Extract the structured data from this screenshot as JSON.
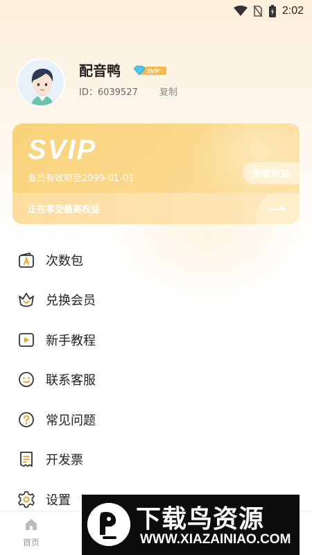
{
  "status_bar": {
    "time": "2:02",
    "icons": [
      "wifi-icon",
      "no-sim-icon",
      "battery-charging-icon"
    ]
  },
  "profile": {
    "username": "配音鸭",
    "badge": "SVIP",
    "user_id": "ID：6039527",
    "copy_label": "复制"
  },
  "svip_card": {
    "logo": "SVIP",
    "expire_text": "会员有效期至2099-01-01",
    "view_rights_label": "查看权益",
    "status_text": "正在享受最高权益"
  },
  "menu": {
    "items": [
      {
        "label": "次数包",
        "icon": "wallet-a-icon"
      },
      {
        "label": "兑换会员",
        "icon": "crown-bag-icon"
      },
      {
        "label": "新手教程",
        "icon": "play-icon"
      },
      {
        "label": "联系客服",
        "icon": "smile-face-icon"
      },
      {
        "label": "常见问题",
        "icon": "question-icon"
      },
      {
        "label": "开发票",
        "icon": "invoice-icon"
      },
      {
        "label": "设置",
        "icon": "gear-icon"
      }
    ]
  },
  "bottom_nav": {
    "home_label": "首页"
  },
  "watermark": {
    "title": "下载鸟资源",
    "url": "WWW.XIAZAINIAO.COM"
  },
  "colors": {
    "card_gold": "#f9d27a",
    "icon_orange": "#f0a020",
    "icon_dark": "#333333"
  }
}
